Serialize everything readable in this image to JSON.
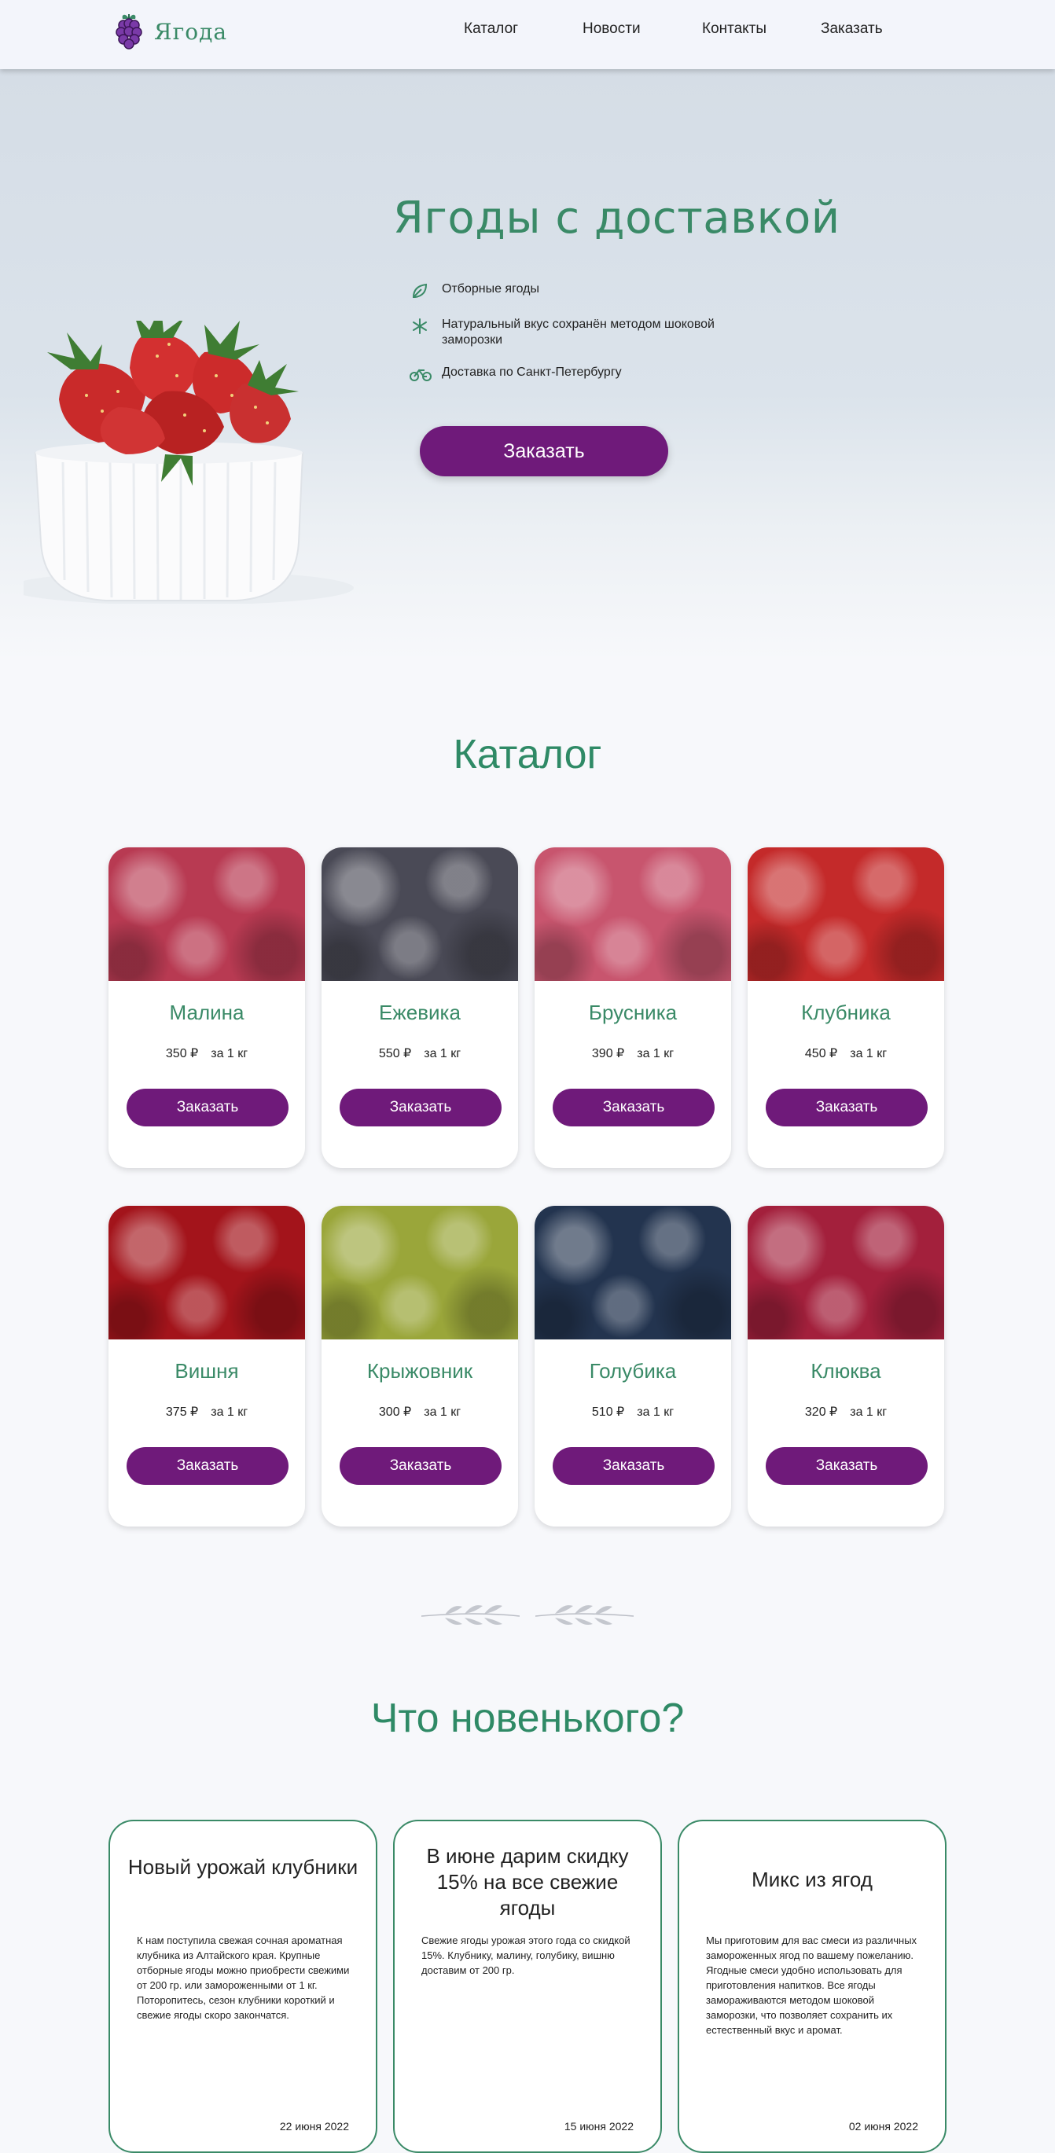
{
  "brand": {
    "name": "Ягода"
  },
  "nav": [
    "Каталог",
    "Новости",
    "Контакты",
    "Заказать"
  ],
  "hero": {
    "title": "Ягоды с доставкой",
    "features": [
      {
        "icon": "leaf-icon",
        "text": "Отборные ягоды"
      },
      {
        "icon": "snowflake-icon",
        "text": "Натуральный вкус сохранён методом шоковой заморозки"
      },
      {
        "icon": "bicycle-icon",
        "text": "Доставка по Санкт-Петербургу"
      }
    ],
    "order_label": "Заказать"
  },
  "catalog": {
    "title": "Каталог",
    "per_unit": "за 1 кг",
    "order_label": "Заказать",
    "items": [
      {
        "name": "Малина",
        "price": "350 ₽",
        "color": "#b83a52"
      },
      {
        "name": "Ежевика",
        "price": "550 ₽",
        "color": "#4a4a56"
      },
      {
        "name": "Брусника",
        "price": "390 ₽",
        "color": "#c8556e"
      },
      {
        "name": "Клубника",
        "price": "450 ₽",
        "color": "#c42a2a"
      },
      {
        "name": "Вишня",
        "price": "375 ₽",
        "color": "#a3141b"
      },
      {
        "name": "Крыжовник",
        "price": "300 ₽",
        "color": "#9aa63a"
      },
      {
        "name": "Голубика",
        "price": "510 ₽",
        "color": "#23344f"
      },
      {
        "name": "Клюква",
        "price": "320 ₽",
        "color": "#a3203c"
      }
    ]
  },
  "news": {
    "title": "Что новенького?",
    "items": [
      {
        "title": "Новый урожай клубники",
        "body": "К нам поступила свежая сочная ароматная клубника из Алтайского края. Крупные отборные ягоды можно приобрести свежими от 200 гр. или замороженными от 1 кг. Поторопитесь, сезон клубники короткий и свежие ягоды скоро закончатся.",
        "date": "22 июня 2022"
      },
      {
        "title": "В июне дарим скидку 15% на все свежие ягоды",
        "body": "Свежие ягоды урожая этого года со скидкой 15%. Клубнику, малину, голубику, вишню доставим от 200 гр.",
        "date": "15 июня 2022"
      },
      {
        "title": "Микс из ягод",
        "body": "Мы приготовим для вас смеси из различных замороженных ягод по вашему пожеланию. Ягодные смеси удобно использовать для приготовления напитков. Все ягоды замораживаются методом шоковой заморозки, что позволяет сохранить их естественный вкус и аромат.",
        "date": "02 июня 2022"
      }
    ]
  },
  "colors": {
    "accent": "#6f1a7a",
    "brand_green": "#3a8a67"
  }
}
